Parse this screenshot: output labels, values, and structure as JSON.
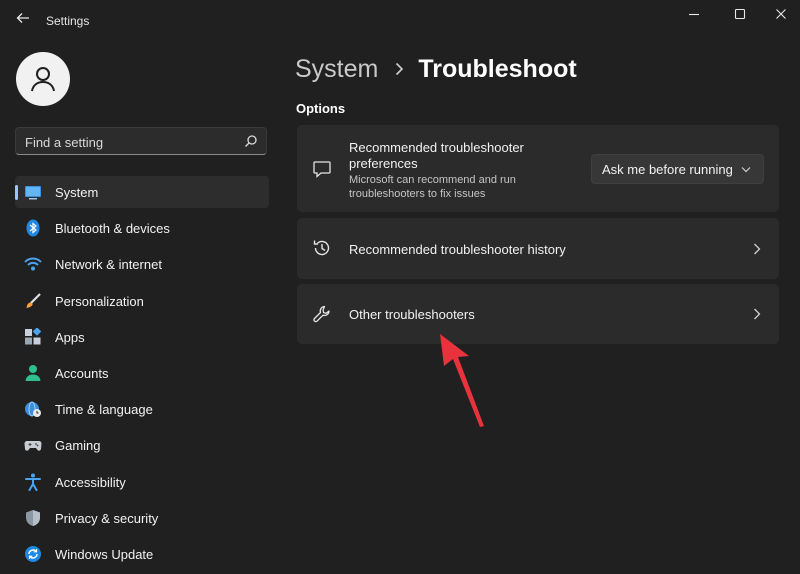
{
  "window": {
    "title": "Settings"
  },
  "search": {
    "placeholder": "Find a setting"
  },
  "sidebar": {
    "items": [
      {
        "label": "System",
        "icon": "display-icon",
        "active": true
      },
      {
        "label": "Bluetooth & devices",
        "icon": "bluetooth-icon"
      },
      {
        "label": "Network & internet",
        "icon": "wifi-icon"
      },
      {
        "label": "Personalization",
        "icon": "paintbrush-icon"
      },
      {
        "label": "Apps",
        "icon": "apps-icon"
      },
      {
        "label": "Accounts",
        "icon": "person-icon"
      },
      {
        "label": "Time & language",
        "icon": "globe-clock-icon"
      },
      {
        "label": "Gaming",
        "icon": "gamepad-icon"
      },
      {
        "label": "Accessibility",
        "icon": "accessibility-icon"
      },
      {
        "label": "Privacy & security",
        "icon": "shield-icon"
      },
      {
        "label": "Windows Update",
        "icon": "update-icon"
      }
    ]
  },
  "breadcrumb": {
    "parent": "System",
    "current": "Troubleshoot"
  },
  "main": {
    "section_title": "Options",
    "cards": [
      {
        "title_line1": "Recommended troubleshooter",
        "title_line2": "preferences",
        "desc_line1": "Microsoft can recommend and run",
        "desc_line2": "troubleshooters to fix issues",
        "dropdown_value": "Ask me before running",
        "icon": "chat-bubble-icon"
      },
      {
        "title": "Recommended troubleshooter history",
        "icon": "history-icon"
      },
      {
        "title": "Other troubleshooters",
        "icon": "wrench-icon"
      }
    ]
  },
  "colors": {
    "background": "#202020",
    "card": "#2b2b2b",
    "accent": "#9fc1ff",
    "annotation_arrow": "#e8323c"
  }
}
